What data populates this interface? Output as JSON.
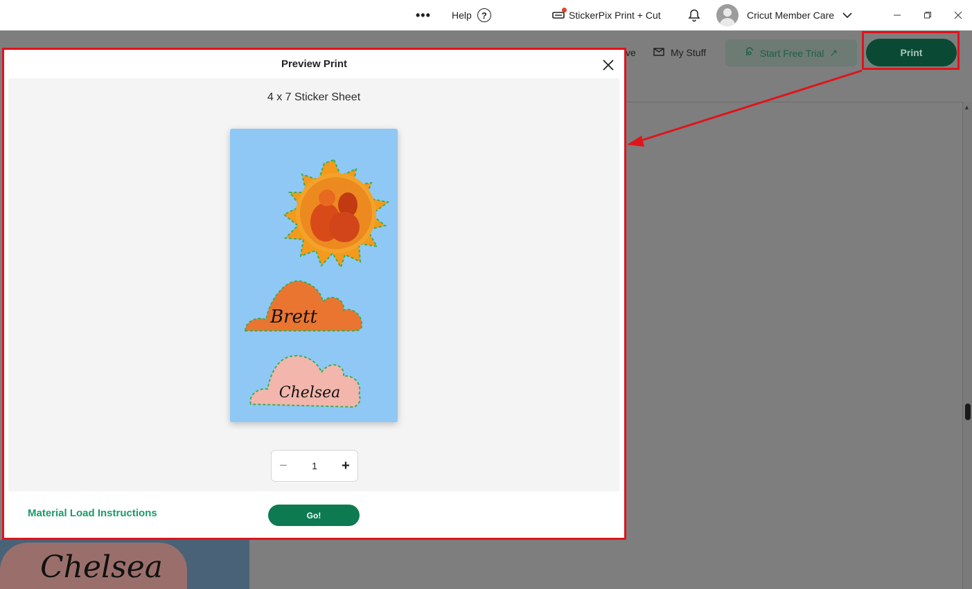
{
  "titlebar": {
    "more_icon": "more-horizontal-icon",
    "help_label": "Help",
    "machine_label": "StickerPix Print + Cut",
    "account_name": "Cricut Member Care"
  },
  "toolbar": {
    "save_partial": "ve",
    "my_stuff_label": "My Stuff",
    "trial_label": "Start Free Trial",
    "print_label": "Print"
  },
  "modal": {
    "title": "Preview Print",
    "sheet_label": "4 x 7 Sticker Sheet",
    "stickers": [
      "Brett",
      "Chelsea"
    ],
    "quantity": "1",
    "material_link": "Material Load Instructions",
    "go_label": "Go!"
  },
  "canvas": {
    "background_sticker_text": "Chelsea"
  },
  "colors": {
    "accent_green": "#0e7a52",
    "dark_green": "#0a4a34",
    "annotation_red": "#e0141b",
    "sheet_blue": "#8fc8f5",
    "cloud_orange": "#ea7531",
    "cloud_pink": "#f2b6ac"
  }
}
